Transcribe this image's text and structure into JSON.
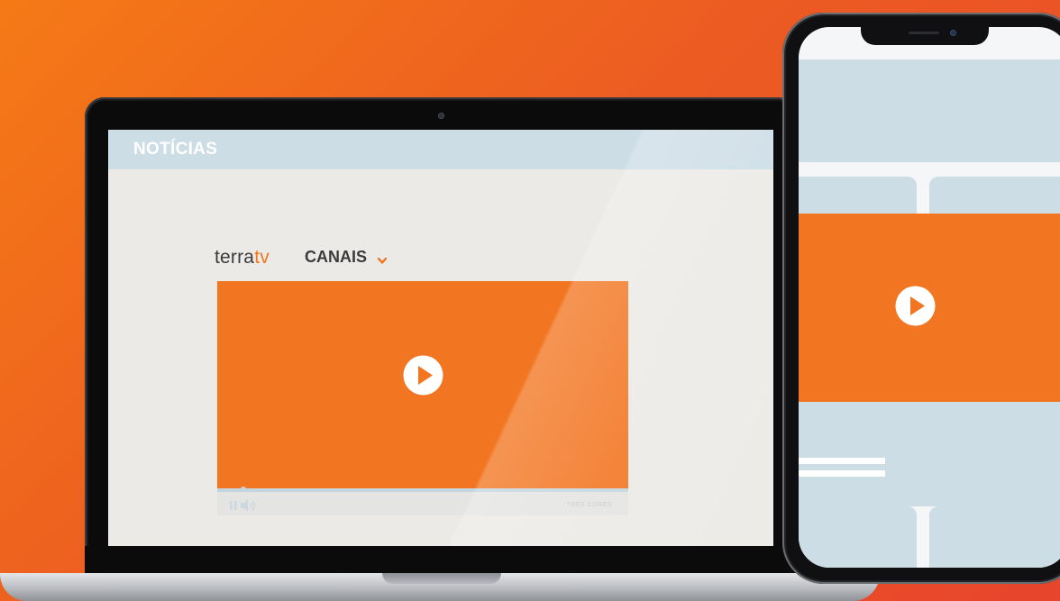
{
  "laptop": {
    "header": {
      "title": "NOTÍCIAS"
    },
    "brand": {
      "part1": "terra",
      "part2": "tv"
    },
    "nav": {
      "channels_label": "CANAIS"
    },
    "player": {
      "label": "TRES CORES"
    }
  },
  "colors": {
    "background_start": "#f57a16",
    "background_end": "#e8452c",
    "video": "#f27622",
    "header": "#cddde6",
    "placeholder": "#cddde6",
    "brand_accent": "#f07620"
  },
  "icons": {
    "play": "play-circle-icon",
    "chevron": "chevron-down-icon",
    "pause": "pause-icon",
    "volume": "volume-icon"
  }
}
